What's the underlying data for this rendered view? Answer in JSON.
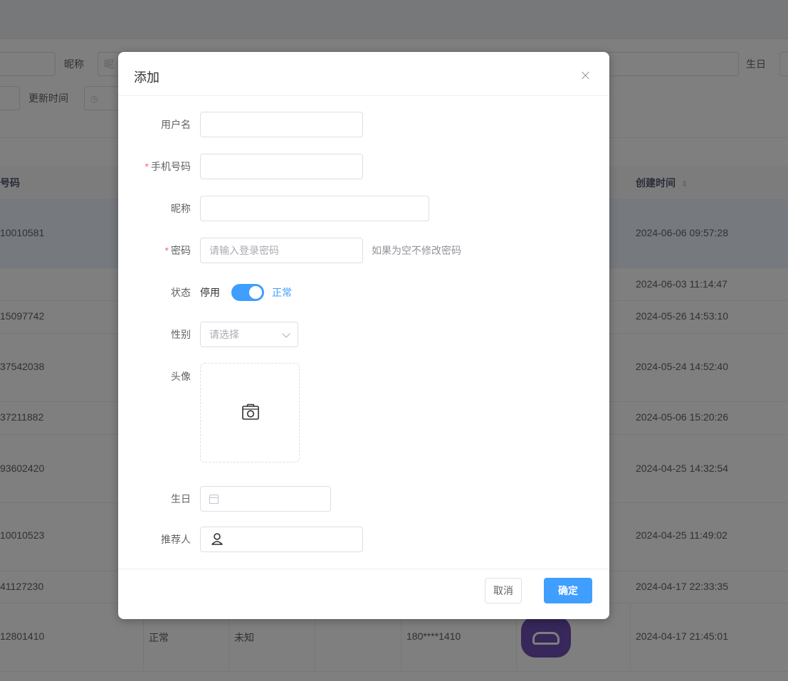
{
  "background": {
    "search": {
      "nickname_label": "昵称",
      "nickname_placeholder": "昵",
      "birthday_label": "生日",
      "update_time_label": "更新时间"
    },
    "table": {
      "headers": {
        "phone": "号码",
        "created": "创建时间"
      },
      "rows": [
        {
          "phone": "10010581",
          "status": "",
          "gender": "",
          "masked": "",
          "created": "2024-06-06 09:57:28"
        },
        {
          "phone": "",
          "status": "",
          "gender": "",
          "masked": "",
          "created": "2024-06-03 11:14:47"
        },
        {
          "phone": "15097742",
          "status": "",
          "gender": "",
          "masked": "",
          "created": "2024-05-26 14:53:10"
        },
        {
          "phone": "37542038",
          "status": "",
          "gender": "",
          "masked": "",
          "created": "2024-05-24 14:52:40"
        },
        {
          "phone": "37211882",
          "status": "",
          "gender": "",
          "masked": "",
          "created": "2024-05-06 15:20:26"
        },
        {
          "phone": "93602420",
          "status": "",
          "gender": "",
          "masked": "",
          "created": "2024-04-25 14:32:54"
        },
        {
          "phone": "10010523",
          "status": "",
          "gender": "",
          "masked": "",
          "created": "2024-04-25 11:49:02"
        },
        {
          "phone": "41127230",
          "status": "",
          "gender": "",
          "masked": "",
          "created": "2024-04-17 22:33:35"
        },
        {
          "phone": "12801410",
          "status": "正常",
          "gender": "未知",
          "masked": "180****1410",
          "created": "2024-04-17 21:45:01"
        }
      ],
      "avatar_color": "#6e4fb4"
    }
  },
  "dialog": {
    "title": "添加",
    "close_icon": "close-icon",
    "required_mark": "*",
    "fields": {
      "username": {
        "label": "用户名",
        "value": ""
      },
      "phone": {
        "label": "手机号码",
        "value": ""
      },
      "nickname": {
        "label": "昵称",
        "value": ""
      },
      "password": {
        "label": "密码",
        "placeholder": "请输入登录密码",
        "hint": "如果为空不修改密码"
      },
      "status": {
        "label": "状态",
        "off_text": "停用",
        "on_text": "正常",
        "on": true
      },
      "gender": {
        "label": "性别",
        "placeholder": "请选择"
      },
      "avatar": {
        "label": "头像",
        "icon": "camera-icon"
      },
      "birthday": {
        "label": "生日",
        "icon": "calendar-icon"
      },
      "referrer": {
        "label": "推荐人",
        "icon": "user-icon"
      }
    },
    "footer": {
      "cancel": "取消",
      "confirm": "确定"
    },
    "accent_color": "#409eff"
  }
}
